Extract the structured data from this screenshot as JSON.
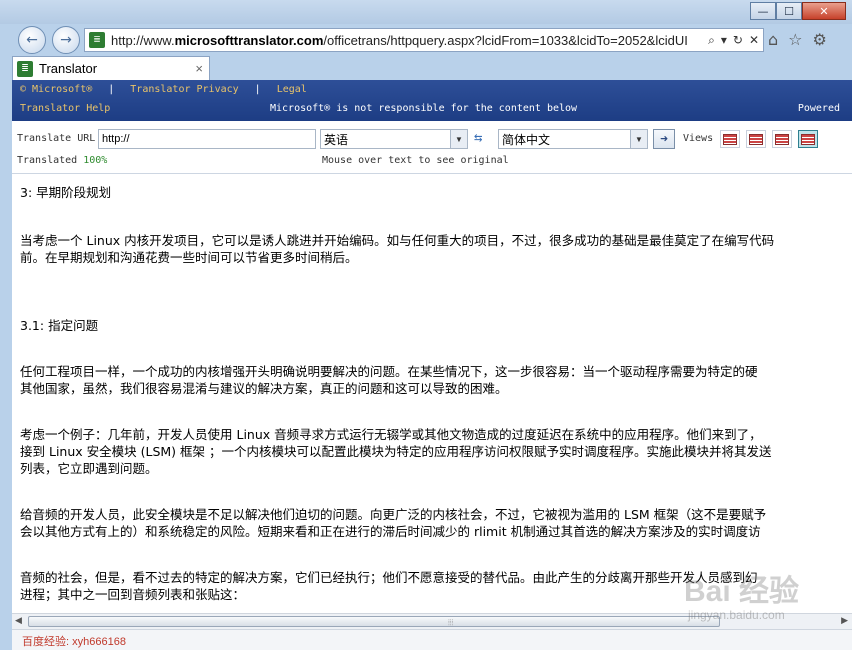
{
  "browser": {
    "url_prefix": "http://www.",
    "url_domain": "microsofttranslator.com",
    "url_rest": "/officetrans/httpquery.aspx?lcidFrom=1033&lcidTo=2052&lcidUI",
    "nav_back_icon": "back-arrow-icon",
    "nav_forward_icon": "forward-arrow-icon",
    "search_glyph": "⌕",
    "dropdown_glyph": "▾",
    "refresh_glyph": "↻",
    "stop_glyph": "✕",
    "home_glyph": "⌂",
    "favorites_glyph": "☆",
    "tools_glyph": "⚙",
    "back_glyph": "←",
    "forward_glyph": "→",
    "min_glyph": "—",
    "max_glyph": "☐",
    "close_glyph": "✕"
  },
  "tab": {
    "label": "Translator",
    "close_glyph": "×",
    "favicon_text": "≣"
  },
  "header": {
    "microsoft": "© Microsoft®",
    "privacy": "Translator Privacy",
    "legal": "Legal",
    "help": "Translator Help",
    "notice": "Microsoft® is not responsible for the content below",
    "powered": "Powered",
    "sep": "|"
  },
  "controls": {
    "translate_url_label": "Translate URL",
    "url_value": "http://",
    "from_lang": "英语",
    "to_lang": "简体中文",
    "swap_glyph": "⇆",
    "go_glyph": "➜",
    "views_label": "Views",
    "translated_label": "Translated",
    "translated_pct": "100%",
    "mouse_over_hint": "Mouse over text to see original",
    "arrow_glyph": "▼"
  },
  "content": {
    "p1": "3: 早期阶段规划",
    "p2a": "当考虑一个 Linux 内核开发项目，它可以是诱人跳进并开始编码。如与任何重大的项目，不过，很多成功的基础是最佳莫定了在编写代码",
    "p2b": "前。在早期规划和沟通花费一些时间可以节省更多时间稍后。",
    "p3": "3.1: 指定问题",
    "p4a": "任何工程项目一样，一个成功的内核增强开头明确说明要解决的问题。在某些情况下，这一步很容易：当一个驱动程序需要为特定的硬",
    "p4b": "其他国家，虽然，我们很容易混淆与建议的解决方案，真正的问题和这可以导致的困难。",
    "p5a": "考虑一个例子：几年前，开发人员使用 Linux 音频寻求方式运行无辍学或其他文物造成的过度延迟在系统中的应用程序。他们来到了，",
    "p5b": "接到 Linux 安全模块 (LSM) 框架 ；一个内核模块可以配置此模块为特定的应用程序访问权限赋予实时调度程序。实施此模块并将其发送",
    "p5c": "列表，它立即遇到问题。",
    "p6a": "给音频的开发人员，此安全模块是不足以解决他们迫切的问题。向更广泛的内核社会，不过，它被视为滥用的 LSM 框架（这不是要赋予",
    "p6b": "会以其他方式有上的）和系统稳定的风险。短期来看和正在进行的滞后时间减少的 rlimit 机制通过其首选的解决方案涉及的实时调度访",
    "p7a": "音频的社会，但是，看不过去的特定的解决方案，它们已经执行；他们不愿意接受的替代品。由此产生的分歧离开那些开发人员感到幻",
    "p7b": "进程；其中之一回到音频列表和张贴这："
  },
  "scroll": {
    "left_glyph": "◀",
    "right_glyph": "▶",
    "grip_glyph": "⦙⦙⦙"
  },
  "status": {
    "text": "百度经验: xyh666168"
  },
  "watermark": {
    "logo": "Bai 经验",
    "url": "jingyan.baidu.com"
  }
}
